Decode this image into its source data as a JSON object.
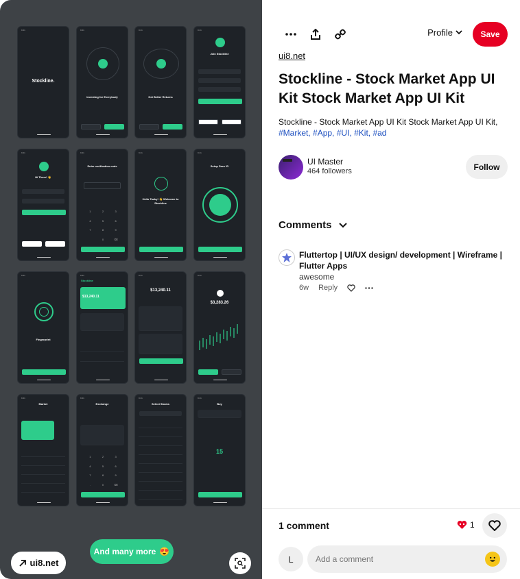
{
  "image_panel": {
    "source_badge": "ui8.net",
    "more_badge": "And many more",
    "more_emoji": "😍",
    "phones": {
      "splash_brand": "Stockline.",
      "invest_title": "Investing for Everybody",
      "returns_title": "Get Better Returns",
      "join_title": "Join Stockline",
      "hi_title": "Hi There! 👋",
      "verify_title": "Enter verification code",
      "welcome_title": "Hello Tacky! 👋 Welcome to Stockline",
      "face_title": "Setup Face ID",
      "finger_title": "Fingerprint",
      "dash_brand": "Stockline",
      "dash_value": "$13,240.11",
      "portfolio_value": "$13,240.11",
      "stock_price": "$3,283.26",
      "market_title": "Market",
      "exchange_title": "Exchange",
      "select_title": "Select Stocks",
      "buy_title": "Buy",
      "buy_amount": "15"
    }
  },
  "toolbar": {
    "more_icon": "more-icon",
    "share_icon": "share-icon",
    "link_icon": "link-icon",
    "profile_label": "Profile",
    "save_label": "Save"
  },
  "pin": {
    "source_link": "ui8.net",
    "title": "Stockline - Stock Market App UI Kit Stock Market App UI Kit",
    "description": "Stockline - Stock Market App UI Kit Stock Market App UI Kit,",
    "tags": [
      "#Market,",
      "#App,",
      "#UI,",
      "#Kit,",
      "#ad"
    ]
  },
  "author": {
    "name": "UI Master",
    "followers": "464 followers",
    "follow_label": "Follow"
  },
  "comments": {
    "heading": "Comments",
    "items": [
      {
        "author": "Fluttertop | UI/UX design/ development | Wireframe | Flutter Apps",
        "text": "awesome",
        "age": "6w",
        "reply_label": "Reply"
      }
    ],
    "count_label": "1 comment",
    "reaction_count": "1",
    "user_initial": "L",
    "input_placeholder": "Add a comment"
  },
  "colors": {
    "brand_red": "#e60023",
    "accent_green": "#2ecc8b",
    "panel_bg": "#3e4246",
    "tag_blue": "#1a4dbf"
  }
}
